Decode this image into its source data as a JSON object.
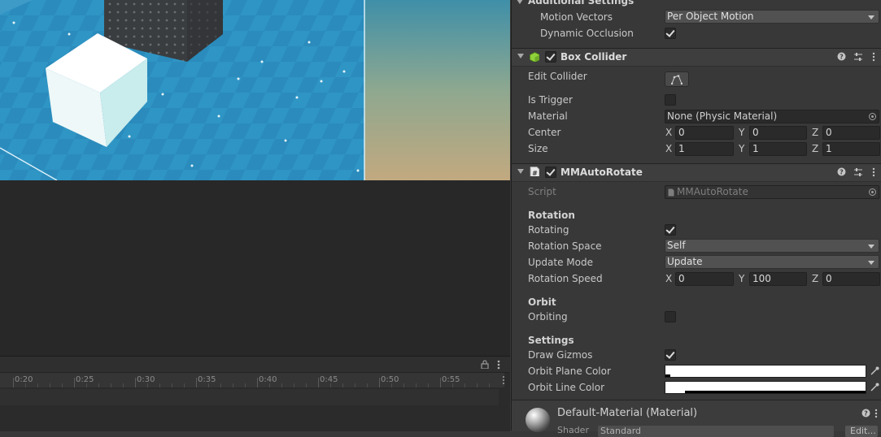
{
  "inspector": {
    "top_section_title": "Additional Settings",
    "motion_vectors": {
      "label": "Motion Vectors",
      "value": "Per Object Motion"
    },
    "dynamic_occlusion": {
      "label": "Dynamic Occlusion",
      "checked": true
    },
    "box_collider": {
      "title": "Box Collider",
      "edit_collider_label": "Edit Collider",
      "is_trigger_label": "Is Trigger",
      "material_label": "Material",
      "material_value": "None (Physic Material)",
      "center_label": "Center",
      "center": {
        "x": "0",
        "y": "0",
        "z": "0"
      },
      "size_label": "Size",
      "size": {
        "x": "1",
        "y": "1",
        "z": "1"
      }
    },
    "auto_rotate": {
      "title": "MMAutoRotate",
      "script_label": "Script",
      "script_value": "MMAutoRotate",
      "rotation_header": "Rotation",
      "rotating_label": "Rotating",
      "rotation_space_label": "Rotation Space",
      "rotation_space_value": "Self",
      "update_mode_label": "Update Mode",
      "update_mode_value": "Update",
      "rotation_speed_label": "Rotation Speed",
      "rotation_speed": {
        "x": "0",
        "y": "100",
        "z": "0"
      },
      "orbit_header": "Orbit",
      "orbiting_label": "Orbiting",
      "settings_header": "Settings",
      "draw_gizmos_label": "Draw Gizmos",
      "orbit_plane_color_label": "Orbit Plane Color",
      "orbit_line_color_label": "Orbit Line Color"
    },
    "material": {
      "title": "Default-Material (Material)",
      "shader_label": "Shader",
      "shader_value": "Standard",
      "edit_label": "Edit..."
    },
    "axis": {
      "x": "X",
      "y": "Y",
      "z": "Z"
    }
  },
  "timeline": {
    "ticks": [
      "0:20",
      "0:25",
      "0:30",
      "0:35",
      "0:40",
      "0:45",
      "0:50",
      "0:55"
    ]
  }
}
